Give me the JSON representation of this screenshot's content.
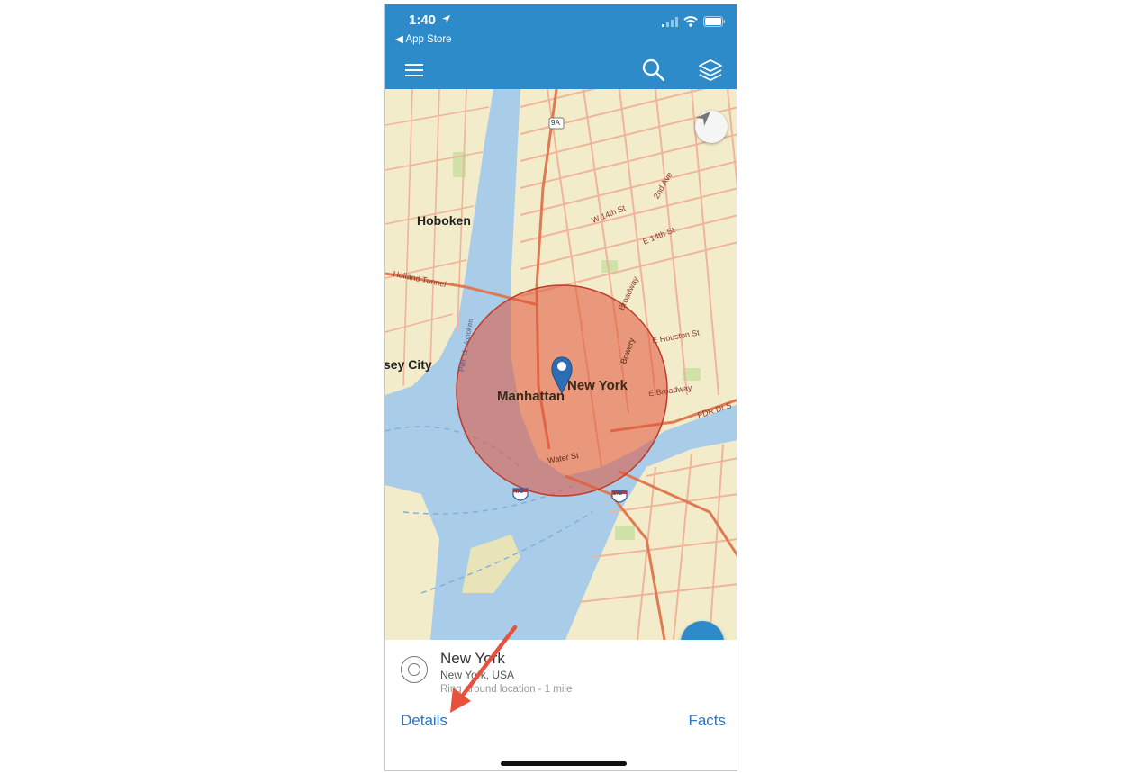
{
  "status": {
    "time": "1:40",
    "back_label": "◀ App Store"
  },
  "toolbar": {
    "menu_icon": "hamburger-icon",
    "search_icon": "search-icon",
    "layers_icon": "layers-icon"
  },
  "map": {
    "labels": {
      "hoboken": "Hoboken",
      "jersey_city": "sey City",
      "manhattan": "Manhattan",
      "new_york": "New York",
      "holland_tunnel": "Holland Tunnel",
      "e_houston": "E Houston St",
      "e_broadway": "E Broadway",
      "fdr": "FDR Dr S",
      "water_st": "Water St",
      "bowery": "Bowery",
      "broadway": "Broadway",
      "second_ave": "2nd Ave",
      "e_14th": "E 14th St",
      "w_14th": "W 14th St",
      "hudson": "Pier 11-Hoboken",
      "i478": "478",
      "i278": "278",
      "r9a": "9A"
    },
    "buffer_color": "#e0543a",
    "pin_color": "#2d6db6"
  },
  "panel": {
    "title": "New York",
    "subtitle": "New York, USA",
    "description": "Ring around location - 1 mile",
    "details_label": "Details",
    "facts_label": "Facts"
  },
  "colors": {
    "accent": "#2e8bca",
    "link": "#2a73c9",
    "annotation_arrow": "#e8513c"
  }
}
